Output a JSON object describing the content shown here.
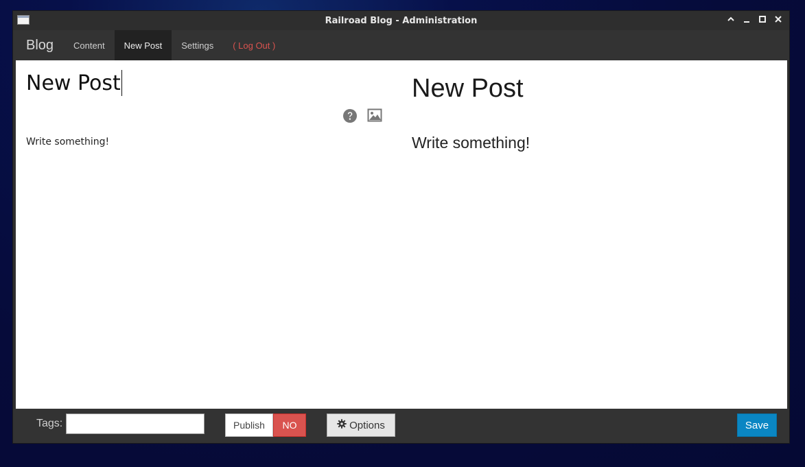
{
  "window": {
    "title": "Railroad Blog - Administration"
  },
  "navbar": {
    "brand": "Blog",
    "items": [
      {
        "label": "Content"
      },
      {
        "label": "New Post"
      },
      {
        "label": "Settings"
      },
      {
        "label": "( Log Out )"
      }
    ],
    "active": "New Post"
  },
  "editor": {
    "title": "New Post",
    "body": "Write something!",
    "icons": [
      "help-icon",
      "image-icon"
    ]
  },
  "preview": {
    "title": "New Post",
    "body": "Write something!"
  },
  "footer": {
    "tags_label": "Tags:",
    "tags_value": "",
    "publish_label": "Publish",
    "publish_state": "NO",
    "options_label": "Options",
    "save_label": "Save"
  },
  "colors": {
    "logout": "#d9534f",
    "publish_no": "#d9534f",
    "save": "#0a86c3"
  }
}
